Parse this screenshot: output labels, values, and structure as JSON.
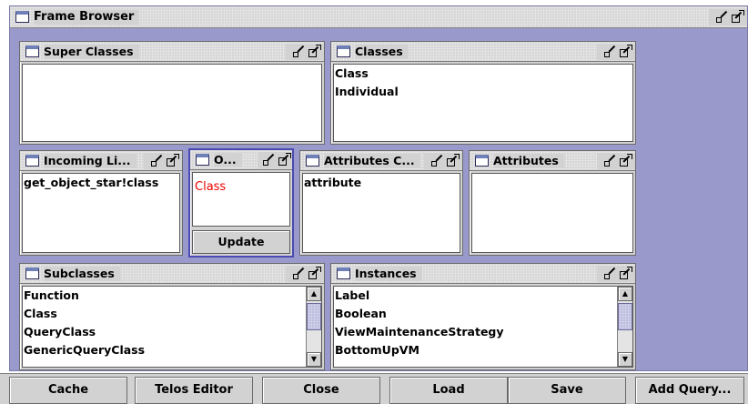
{
  "window": {
    "title": "Frame Browser"
  },
  "panels": {
    "super_classes": {
      "title": "Super Classes",
      "items": []
    },
    "classes": {
      "title": "Classes",
      "items": [
        "Class",
        "Individual"
      ]
    },
    "incoming_links": {
      "title": "Incoming Li...",
      "items": [
        "get_object_star!class"
      ]
    },
    "object": {
      "title": "O...",
      "value": "Class",
      "update_label": "Update"
    },
    "attributes_categories": {
      "title": "Attributes C...",
      "items": [
        "attribute"
      ]
    },
    "attributes": {
      "title": "Attributes",
      "items": []
    },
    "subclasses": {
      "title": "Subclasses",
      "items": [
        "Function",
        "Class",
        "QueryClass",
        "GenericQueryClass"
      ]
    },
    "instances": {
      "title": "Instances",
      "items": [
        "Label",
        "Boolean",
        "ViewMaintenanceStrategy",
        "BottomUpVM"
      ]
    }
  },
  "buttons": [
    "Cache",
    "Telos Editor",
    "Close",
    "Load",
    "Save",
    "Add Query..."
  ],
  "icons": {
    "window": "window-icon",
    "minimize": "minimize-icon",
    "maximize": "maximize-icon",
    "scroll_up": "scroll-up-icon",
    "scroll_down": "scroll-down-icon"
  },
  "colors": {
    "desktop": "#9999cc",
    "panel": "#d2d2d2",
    "selected_border": "#4a4ab0",
    "object_value": "#ee0000"
  }
}
